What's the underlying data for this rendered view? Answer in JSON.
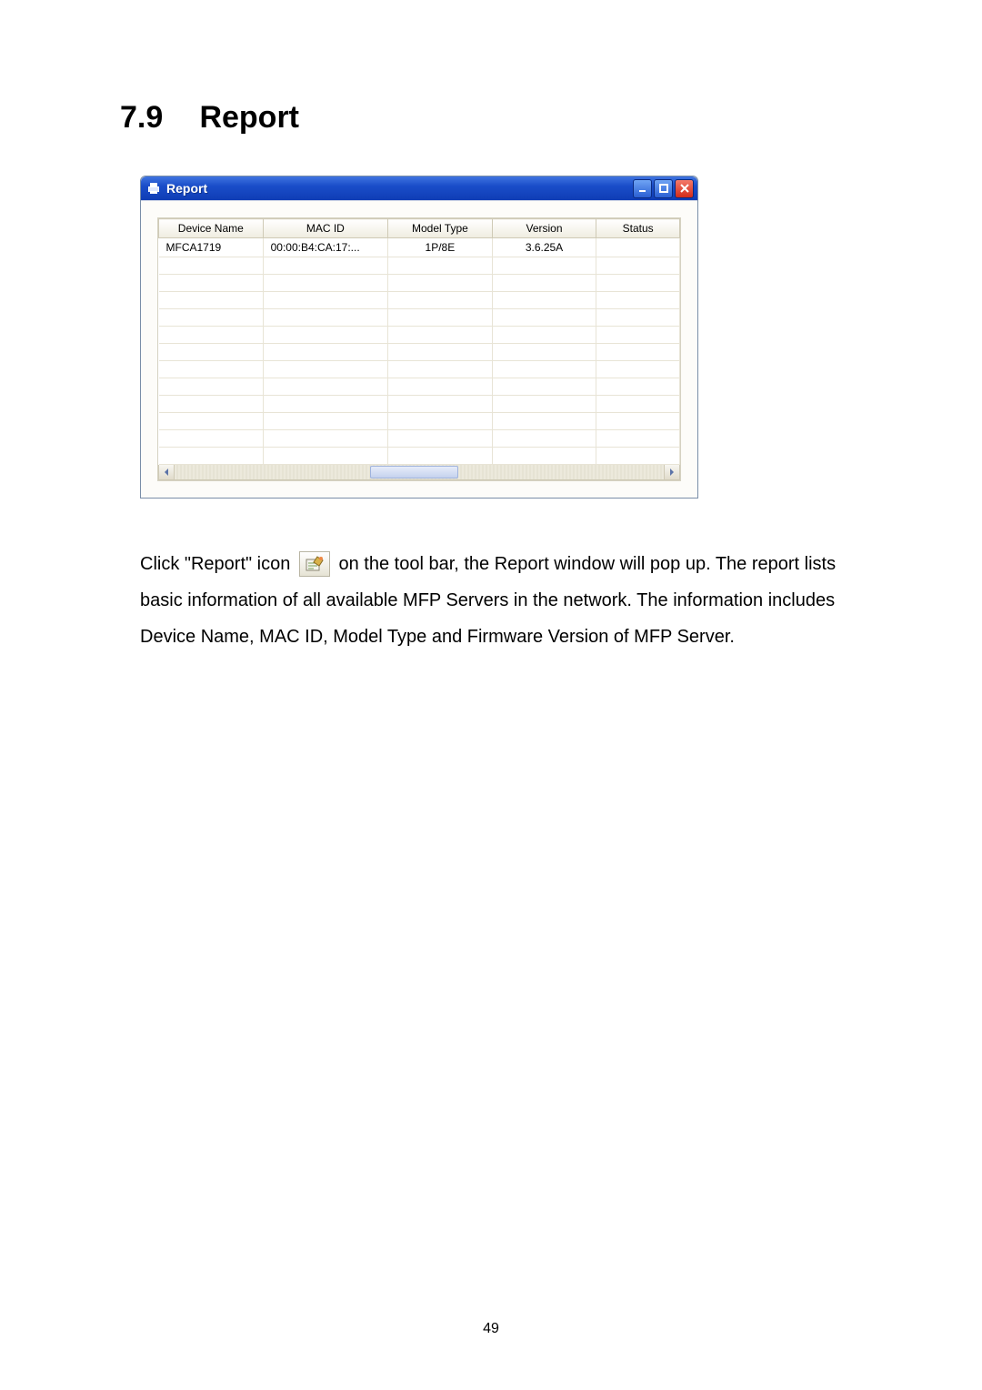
{
  "heading": {
    "number": "7.9",
    "title": "Report"
  },
  "window": {
    "title": "Report",
    "columns": [
      "Device Name",
      "MAC ID",
      "Model Type",
      "Version",
      "Status"
    ],
    "rows": [
      {
        "device_name": "MFCA1719",
        "mac_id": "00:00:B4:CA:17:...",
        "model_type": "1P/8E",
        "version": "3.6.25A",
        "status": ""
      }
    ],
    "blank_row_count": 12
  },
  "paragraph": {
    "pre_icon": "Click \"Report\" icon ",
    "post_icon": " on the tool bar, the Report window will pop up. The report lists basic information of all available MFP Servers in the network. The information includes Device Name, MAC ID, Model Type and Firmware Version of MFP Server."
  },
  "page_number": "49",
  "icons": {
    "title_icon": "printer-icon",
    "toolbar_icon": "report-icon"
  }
}
